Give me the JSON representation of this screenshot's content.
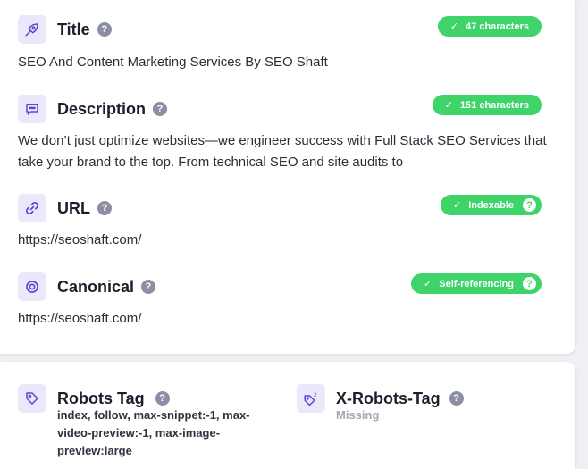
{
  "fields": {
    "title": {
      "label": "Title",
      "help": "?",
      "badge": "47 characters",
      "value": "SEO And Content Marketing Services By SEO Shaft"
    },
    "description": {
      "label": "Description",
      "help": "?",
      "badge": "151 characters",
      "value": "We don’t just optimize websites—we engineer success with Full Stack SEO Services that take your brand to the top. From technical SEO and site audits to"
    },
    "url": {
      "label": "URL",
      "help": "?",
      "badge": "Indexable",
      "badge_help": "?",
      "value": "https://seoshaft.com/"
    },
    "canonical": {
      "label": "Canonical",
      "help": "?",
      "badge": "Self-referencing",
      "badge_help": "?",
      "value": "https://seoshaft.com/"
    }
  },
  "robots": {
    "robots_tag": {
      "label": "Robots Tag",
      "help": "?",
      "value": "index, follow, max-snippet:-1, max-video-preview:-1, max-image-preview:large"
    },
    "x_robots_tag": {
      "label": "X-Robots-Tag",
      "help": "?",
      "value": "Missing"
    }
  },
  "check_glyph": "✓",
  "icons": {
    "title": "pen-nib-icon",
    "description": "comment-dots-icon",
    "url": "link-icon",
    "canonical": "target-icon",
    "robots_tag": "tag-icon",
    "x_robots_tag": "tag-superscript-icon"
  },
  "colors": {
    "accent": "#5b45d6",
    "icon_bg": "#ebe8fb",
    "badge_green": "#3fd46a",
    "help_gray": "#8c8fa3",
    "muted": "#a3a6b4"
  }
}
